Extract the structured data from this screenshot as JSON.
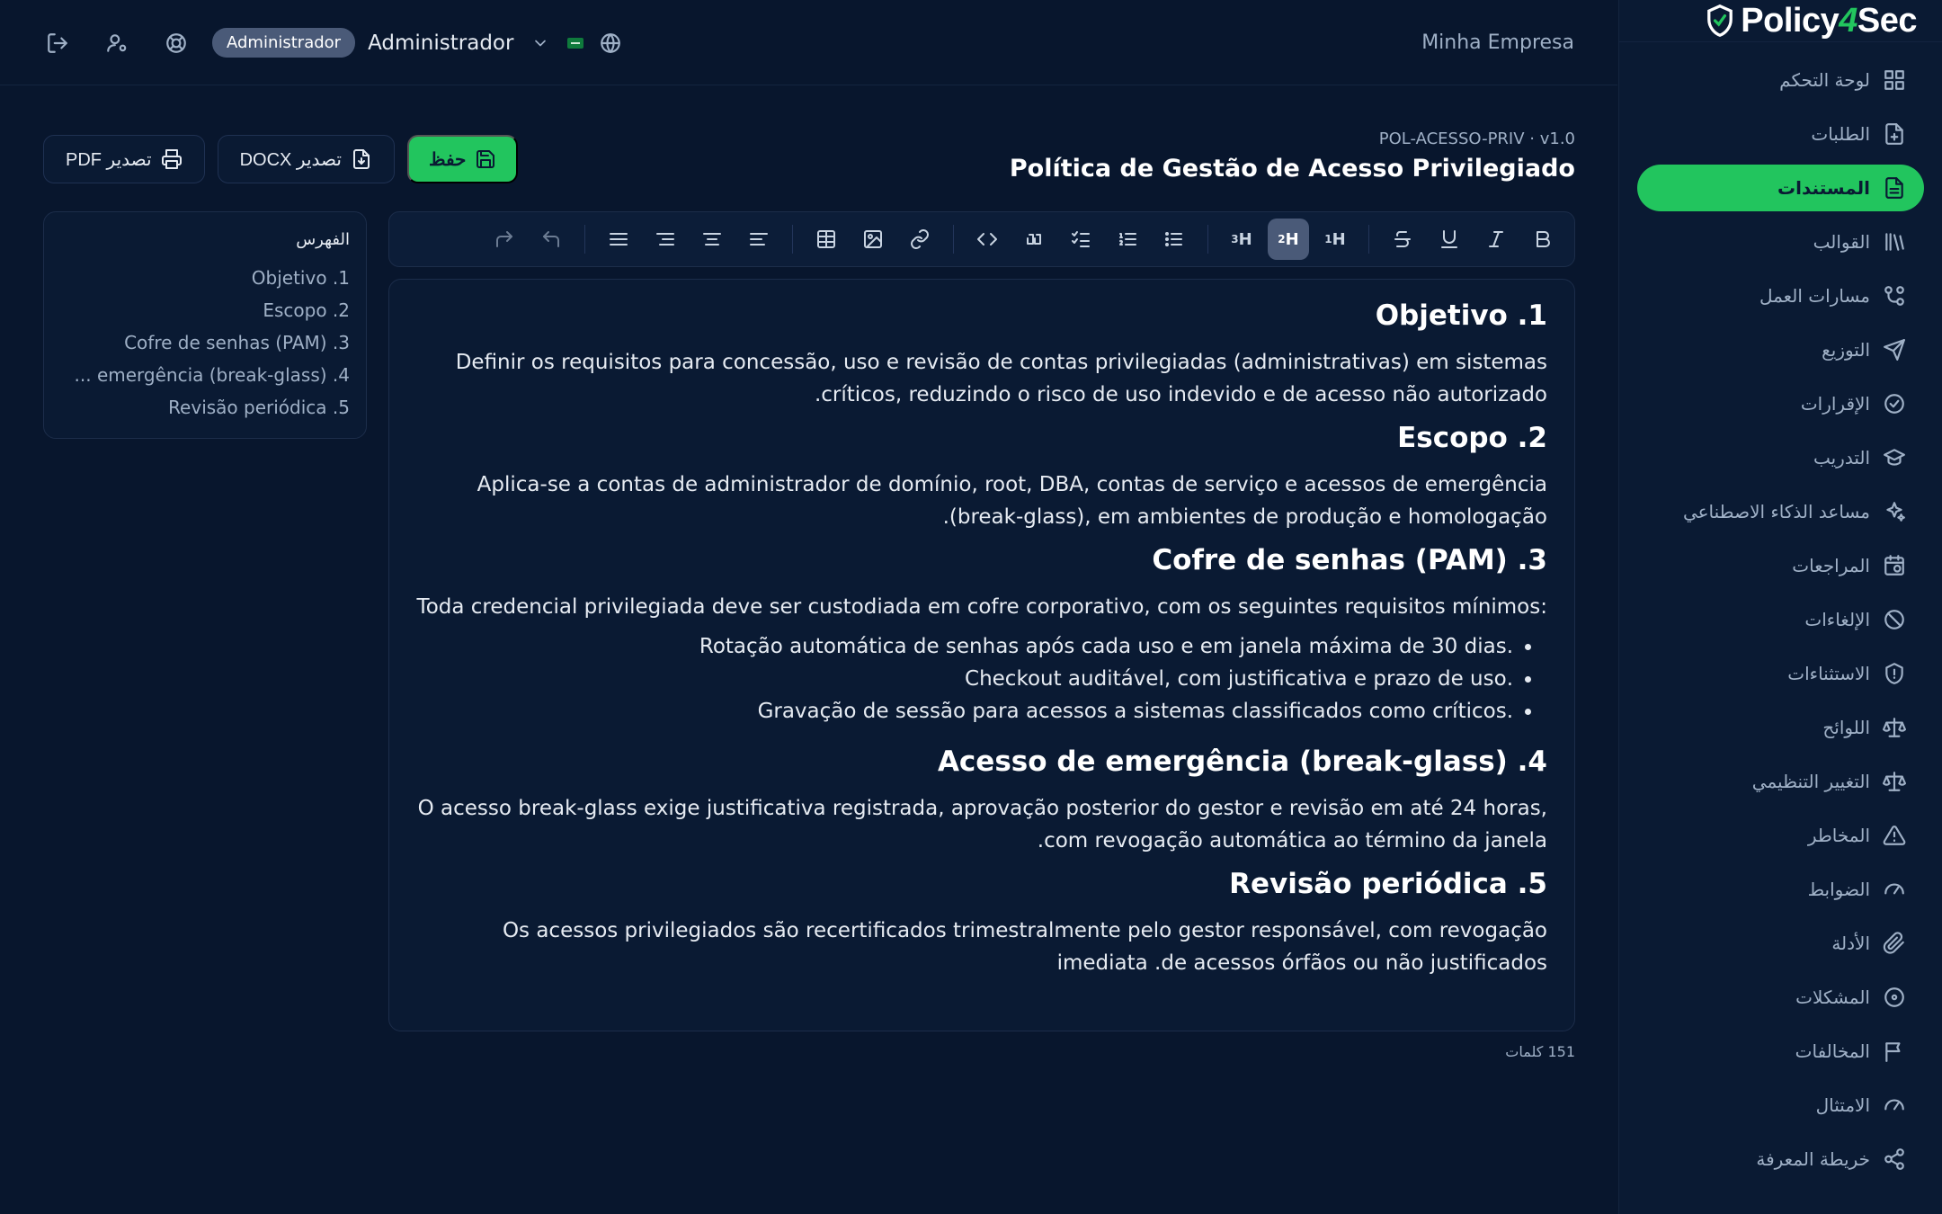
{
  "brand": {
    "name_pre": "Policy",
    "name_four": "4",
    "name_post": "Sec"
  },
  "topbar": {
    "company": "Minha Empresa",
    "role_badge": "Administrador",
    "user_name": "Administrador"
  },
  "sidebar": {
    "items": [
      {
        "label": "لوحة التحكم",
        "icon": "dashboard-icon",
        "active": false
      },
      {
        "label": "الطلبات",
        "icon": "request-icon",
        "active": false
      },
      {
        "label": "المستندات",
        "icon": "document-icon",
        "active": true
      },
      {
        "label": "القوالب",
        "icon": "library-icon",
        "active": false
      },
      {
        "label": "مسارات العمل",
        "icon": "workflow-icon",
        "active": false
      },
      {
        "label": "التوزيع",
        "icon": "send-icon",
        "active": false
      },
      {
        "label": "الإقرارات",
        "icon": "check-circle-icon",
        "active": false
      },
      {
        "label": "التدريب",
        "icon": "graduation-cap-icon",
        "active": false
      },
      {
        "label": "مساعد الذكاء الاصطناعي",
        "icon": "sparkles-icon",
        "active": false
      },
      {
        "label": "المراجعات",
        "icon": "calendar-clock-icon",
        "active": false
      },
      {
        "label": "الإلغاءات",
        "icon": "ban-icon",
        "active": false
      },
      {
        "label": "الاستثناءات",
        "icon": "shield-alert-icon",
        "active": false
      },
      {
        "label": "اللوائح",
        "icon": "scale-icon",
        "active": false
      },
      {
        "label": "التغيير التنظيمي",
        "icon": "scale-icon",
        "active": false
      },
      {
        "label": "المخاطر",
        "icon": "warning-icon",
        "active": false
      },
      {
        "label": "الضوابط",
        "icon": "gauge-icon",
        "active": false
      },
      {
        "label": "الأدلة",
        "icon": "paperclip-icon",
        "active": false
      },
      {
        "label": "المشكلات",
        "icon": "circle-dot-icon",
        "active": false
      },
      {
        "label": "المخالفات",
        "icon": "flag-icon",
        "active": false
      },
      {
        "label": "الامتثال",
        "icon": "gauge-icon",
        "active": false
      },
      {
        "label": "خريطة المعرفة",
        "icon": "share-nodes-icon",
        "active": false
      }
    ]
  },
  "doc": {
    "code": "POL-ACESSO-PRIV · v1.0",
    "title": "Política de Gestão de Acesso Privilegiado"
  },
  "actions": {
    "export_pdf": "تصدير PDF",
    "export_docx": "تصدير DOCX",
    "save": "حفظ"
  },
  "toc": {
    "title": "الفهرس",
    "items": [
      "Objetivo .1",
      "Escopo .2",
      "Cofre de senhas (PAM) .3",
      "emergência (break-glass) .4 ...",
      "Revisão periódica .5"
    ]
  },
  "toolbar": {
    "h1": "H",
    "h2": "H",
    "h3": "H",
    "h1_sub": "1",
    "h2_sub": "2",
    "h3_sub": "3"
  },
  "content": {
    "s1_title": "Objetivo .1",
    "s1_text": "Definir os requisitos para concessão, uso e revisão de contas privilegiadas (administrativas) em sistemas .críticos, reduzindo o risco de uso indevido e de acesso não autorizado",
    "s2_title": "Escopo .2",
    "s2_text": "Aplica-se a contas de administrador de domínio, root, DBA, contas de serviço e acessos de emergência (break-glass), em ambientes de produção e homologação.",
    "s3_title": "Cofre de senhas (PAM) .3",
    "s3_text": ":Toda credencial privilegiada deve ser custodiada em cofre corporativo, com os seguintes requisitos mínimos",
    "s3_bullets": [
      ".Rotação automática de senhas após cada uso e em janela máxima de 30 dias",
      ".Checkout auditável, com justificativa e prazo de uso",
      ".Gravação de sessão para acessos a sistemas classificados como críticos"
    ],
    "s4_title": "Acesso de emergência (break-glass) .4",
    "s4_text": "O acesso break-glass exige justificativa registrada, aprovação posterior do gestor e revisão em até 24 horas, .com revogação automática ao término da janela",
    "s5_title": "Revisão periódica .5",
    "s5_text": "Os acessos privilegiados são recertificados trimestralmente pelo gestor responsável, com revogação imediata .de acessos órfãos ou não justificados"
  },
  "word_count": "151 كلمات",
  "colors": {
    "accent": "#22c55e",
    "bg": "#08162d",
    "panel": "#0a1a33"
  }
}
